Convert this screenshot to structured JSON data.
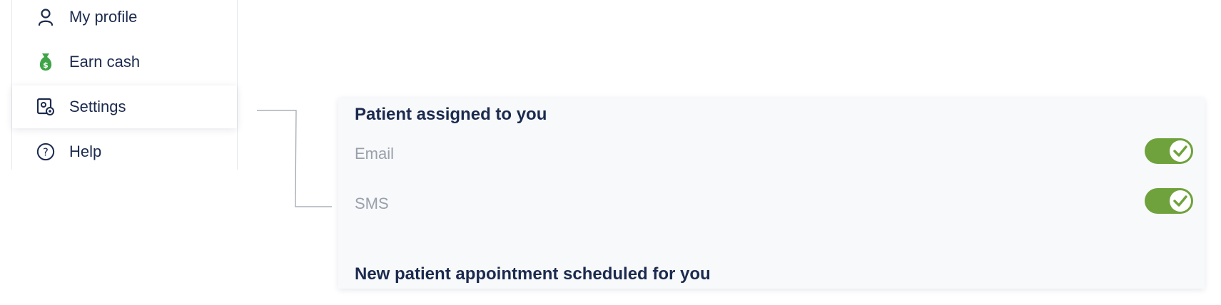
{
  "sidebar": {
    "items": [
      {
        "label": "My profile",
        "icon": "person-icon"
      },
      {
        "label": "Earn cash",
        "icon": "money-bag-icon"
      },
      {
        "label": "Settings",
        "icon": "settings-icon"
      },
      {
        "label": "Help",
        "icon": "help-icon"
      }
    ]
  },
  "panel": {
    "sections": [
      {
        "title": "Patient assigned to you",
        "rows": [
          {
            "label": "Email",
            "enabled": true
          },
          {
            "label": "SMS",
            "enabled": true
          }
        ]
      },
      {
        "title": "New patient appointment scheduled for you"
      }
    ]
  },
  "colors": {
    "text": "#1b2a4e",
    "muted": "#9aa0ab",
    "toggle_on": "#6fa23c",
    "money_bag": "#3fa447"
  }
}
